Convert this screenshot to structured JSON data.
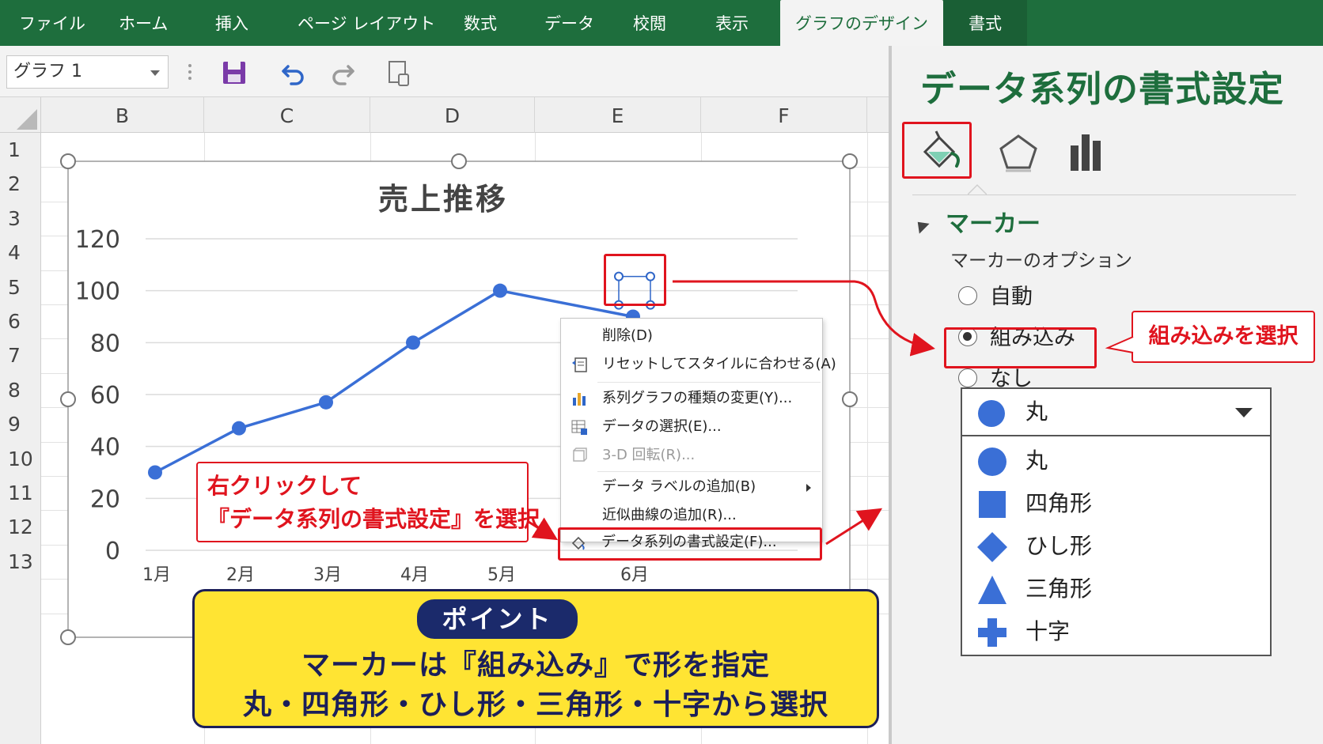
{
  "ribbon": {
    "tabs": [
      "ファイル",
      "ホーム",
      "挿入",
      "ページ レイアウト",
      "数式",
      "データ",
      "校閲",
      "表示",
      "グラフのデザイン",
      "書式"
    ],
    "active_tab": "グラフのデザイン"
  },
  "toolbar": {
    "name_box": "グラフ 1",
    "icons": [
      "save-icon",
      "undo-icon",
      "redo-icon",
      "touch-mode-icon"
    ]
  },
  "sheet": {
    "columns": [
      "B",
      "C",
      "D",
      "E",
      "F"
    ],
    "rows": [
      "1",
      "2",
      "3",
      "4",
      "5",
      "6",
      "7",
      "8",
      "9",
      "10",
      "11",
      "12",
      "13"
    ]
  },
  "chart_data": {
    "type": "line",
    "title": "売上推移",
    "categories": [
      "1月",
      "2月",
      "3月",
      "4月",
      "5月",
      "6月"
    ],
    "series": [
      {
        "values": [
          30,
          47,
          57,
          80,
          100,
          90
        ]
      }
    ],
    "y_ticks": [
      "120",
      "100",
      "80",
      "60",
      "40",
      "20",
      "0"
    ],
    "ylim": [
      0,
      120
    ],
    "grid": true,
    "color": "#3a6fd6"
  },
  "context_menu": {
    "items": [
      {
        "label": "削除(D)",
        "icon": "none"
      },
      {
        "label": "リセットしてスタイルに合わせる(A)",
        "icon": "reset-style-icon"
      },
      {
        "label": "系列グラフの種類の変更(Y)...",
        "icon": "chart-type-icon"
      },
      {
        "label": "データの選択(E)...",
        "icon": "select-data-icon"
      },
      {
        "label": "3-D 回転(R)...",
        "icon": "3d-rotation-icon",
        "disabled": true
      },
      {
        "label": "データ ラベルの追加(B)",
        "icon": "none",
        "submenu": true
      },
      {
        "label": "近似曲線の追加(R)...",
        "icon": "none"
      },
      {
        "label": "データ系列の書式設定(F)...",
        "icon": "format-series-icon"
      }
    ]
  },
  "pane": {
    "title": "データ系列の書式設定",
    "tabs": [
      "fill-line-icon",
      "effects-icon",
      "series-options-icon"
    ],
    "section": "マーカー",
    "subsection": "マーカーのオプション",
    "radios": [
      {
        "label": "自動",
        "checked": false
      },
      {
        "label": "組み込み",
        "checked": true
      },
      {
        "label": "なし",
        "checked": false
      }
    ],
    "shape_select": "丸",
    "shape_options": [
      "丸",
      "四角形",
      "ひし形",
      "三角形",
      "十字"
    ]
  },
  "annotations": {
    "callout_right": "組み込みを選択",
    "callout_left_line1": "右クリックして",
    "callout_left_line2": "『データ系列の書式設定』を選択",
    "point_badge": "ポイント",
    "point_line1": "マーカーは『組み込み』で形を指定",
    "point_line2": "丸・四角形・ひし形・三角形・十字から選択",
    "accent_red": "#e0141e",
    "accent_green": "#1e6e3d",
    "accent_yellow": "#ffe433"
  }
}
